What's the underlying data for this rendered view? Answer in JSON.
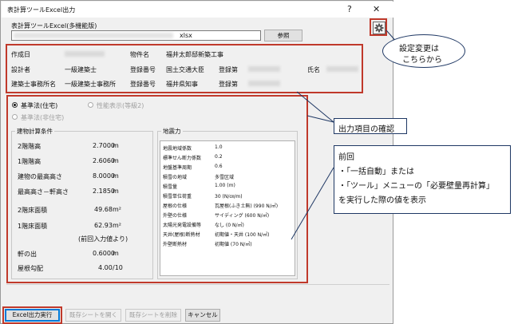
{
  "window": {
    "title": "表計算ツールExcel出力",
    "help": "?",
    "close": "✕"
  },
  "file": {
    "label": "表計算ツールExcel(多機能版)",
    "path_suffix": "xlsx",
    "browse_label": "参照"
  },
  "header": {
    "created_label": "作成日",
    "property_label": "物件名",
    "property_value": "福井太郎邸新築工事",
    "designer_label": "設計者",
    "designer_grade": "一級建築士",
    "reg_no_label": "登録番号",
    "minister": "国土交通大臣",
    "reg_label": "登録第",
    "name_label": "氏名",
    "office_label": "建築士事務所名",
    "office_type": "一級建築士事務所",
    "office_reg_no_label": "登録番号",
    "governor": "福井県知事",
    "office_reg_label": "登録第"
  },
  "standard": {
    "opt1": "基準法(住宅)",
    "opt2": "性能表示(等級2)",
    "opt3": "基準法(非住宅)"
  },
  "building": {
    "title": "建物計算条件",
    "rows": [
      {
        "label": "2階階高",
        "value": "2.7000",
        "unit": "m"
      },
      {
        "label": "1階階高",
        "value": "2.6060",
        "unit": "m"
      },
      {
        "label": "建物の最高高さ",
        "value": "8.0000",
        "unit": "m"
      },
      {
        "label": "最高高さ－軒高さ",
        "value": "2.1850",
        "unit": "m"
      },
      {
        "label": "2階床面積",
        "value": "49.68",
        "unit": "m²"
      },
      {
        "label": "1階床面積",
        "value": "62.93",
        "unit": "m²"
      },
      {
        "label": "",
        "value": "(前回入力値より)",
        "unit": ""
      },
      {
        "label": "軒の出",
        "value": "0.6000",
        "unit": "m"
      },
      {
        "label": "屋根勾配",
        "value": "4.00",
        "unit": "/10"
      }
    ]
  },
  "seismic": {
    "title": "地震力",
    "rows": [
      {
        "label": "地震地域係数",
        "value": "1.0"
      },
      {
        "label": "標準せん断力係数",
        "value": "0.2"
      },
      {
        "label": "地盤基準周期",
        "value": "0.6"
      },
      {
        "label": "積雪の地域",
        "value": "多雪区域"
      },
      {
        "label": "積雪量",
        "value": "1.00 (m)"
      },
      {
        "label": "積雪単位荷重",
        "value": "30 (N/㎝/m)"
      },
      {
        "label": "屋根の仕様",
        "value": "瓦屋根(ふき土無) (990 N/㎡)"
      },
      {
        "label": "外壁の仕様",
        "value": "サイディング (600 N/㎡)"
      },
      {
        "label": "太陽光発電設備等",
        "value": "なし (0 N/㎡)"
      },
      {
        "label": "天井(屋根)断熱材",
        "value": "初期値・天井 (100 N/㎡)"
      },
      {
        "label": "外壁断熱材",
        "value": "初期値 (70 N/㎡)"
      }
    ]
  },
  "footer": {
    "run": "Excel出力実行",
    "open": "既存シートを開く",
    "delete": "既存シートを削除",
    "cancel": "キャンセル"
  },
  "callouts": {
    "settings": [
      "設定変更は",
      "こちらから"
    ],
    "items": "出力項目の確認",
    "previous": [
      "前回",
      "・「一括自動」または",
      "・「ツール」メニューの「必要壁量再計算」",
      "を実行した際の値を表示"
    ]
  },
  "colors": {
    "highlight": "#c0392b",
    "callout_border": "#1f3864",
    "focus": "#0078d7"
  }
}
